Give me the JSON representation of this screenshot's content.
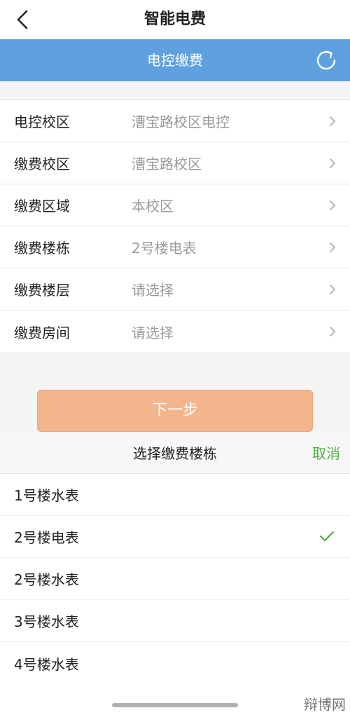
{
  "nav": {
    "title": "智能电费",
    "back_icon": "chevron-left-icon"
  },
  "subbar": {
    "title": "电控缴费",
    "refresh_icon": "refresh-icon",
    "color": "#5fa1de"
  },
  "form": {
    "rows": [
      {
        "label": "电控校区",
        "value": "漕宝路校区电控"
      },
      {
        "label": "缴费校区",
        "value": "漕宝路校区"
      },
      {
        "label": "缴费区域",
        "value": "本校区"
      },
      {
        "label": "缴费楼栋",
        "value": "2号楼电表"
      },
      {
        "label": "缴费楼层",
        "value": "请选择"
      },
      {
        "label": "缴费房间",
        "value": "请选择"
      }
    ]
  },
  "next_button": {
    "label": "下一步",
    "color": "#f3b58b"
  },
  "picker": {
    "title": "选择缴费楼栋",
    "cancel": "取消",
    "options": [
      {
        "label": "1号楼水表",
        "selected": false
      },
      {
        "label": "2号楼电表",
        "selected": true
      },
      {
        "label": "2号楼水表",
        "selected": false
      },
      {
        "label": "3号楼水表",
        "selected": false
      },
      {
        "label": "4号楼水表",
        "selected": false
      }
    ]
  },
  "watermark": "辩博网"
}
